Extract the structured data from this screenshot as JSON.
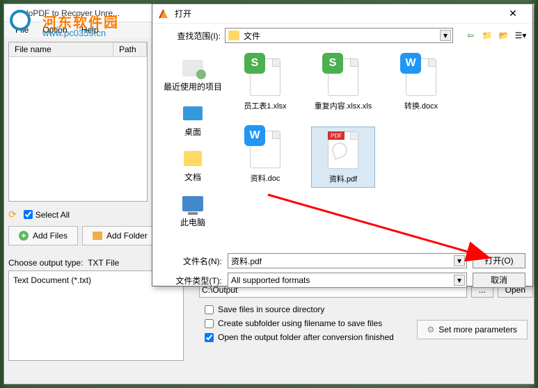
{
  "watermark": {
    "text": "河东软件园",
    "url": "www.pc0359.cn"
  },
  "main": {
    "title": "doPDF to Recover Unre...",
    "menu": {
      "file": "File",
      "option": "Option",
      "help": "Help"
    },
    "table": {
      "name": "File name",
      "path": "Path"
    },
    "selectAll": "Select All",
    "addFiles": "Add Files",
    "addFolder": "Add Folder",
    "chooseOutput": "Choose output type:",
    "outputType": "TXT File",
    "outputItem": "Text Document (*.txt)",
    "outputPath": "C:\\Output",
    "browse": "...",
    "open": "Open",
    "cb1": "Save files in source directory",
    "cb2": "Create subfolder using filename to save files",
    "cb3": "Open the output folder after conversion finished",
    "moreParams": "Set more parameters"
  },
  "dialog": {
    "title": "打开",
    "lookinLabel": "查找范围(I):",
    "lookinValue": "文件",
    "sidebar": {
      "recent": "最近使用的项目",
      "desktop": "桌面",
      "docs": "文档",
      "pc": "此电脑"
    },
    "files": [
      {
        "name": "员工表1.xlsx",
        "type": "s"
      },
      {
        "name": "重复内容.xlsx.xls",
        "type": "s"
      },
      {
        "name": "转换.docx",
        "type": "w"
      },
      {
        "name": "资料.doc",
        "type": "w"
      },
      {
        "name": "资料.pdf",
        "type": "pdf",
        "selected": true
      }
    ],
    "fileNameLabel": "文件名(N):",
    "fileNameValue": "资料.pdf",
    "fileTypeLabel": "文件类型(T):",
    "fileTypeValue": "All supported formats",
    "openBtn": "打开(O)",
    "cancelBtn": "取消"
  }
}
